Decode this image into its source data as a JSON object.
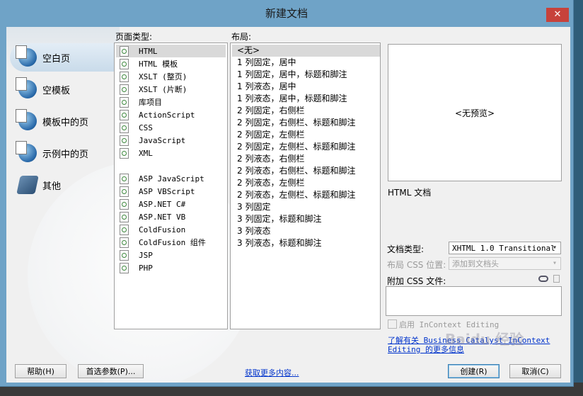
{
  "window": {
    "title": "新建文档",
    "close_label": "✕"
  },
  "categories": [
    {
      "label": "空白页",
      "icon": "blank-page-icon",
      "selected": true
    },
    {
      "label": "空模板",
      "icon": "blank-template-icon",
      "selected": false
    },
    {
      "label": "模板中的页",
      "icon": "template-page-icon",
      "selected": false
    },
    {
      "label": "示例中的页",
      "icon": "sample-page-icon",
      "selected": false
    },
    {
      "label": "其他",
      "icon": "other-icon",
      "selected": false
    }
  ],
  "page_type": {
    "label": "页面类型:",
    "items": [
      "HTML",
      "HTML 模板",
      "XSLT (整页)",
      "XSLT (片断)",
      "库项目",
      "ActionScript",
      "CSS",
      "JavaScript",
      "XML",
      "",
      "ASP JavaScript",
      "ASP VBScript",
      "ASP.NET C#",
      "ASP.NET VB",
      "ColdFusion",
      "ColdFusion 组件",
      "JSP",
      "PHP"
    ],
    "selected_index": 0
  },
  "layout": {
    "label": "布局:",
    "items": [
      "<无>",
      "1 列固定，居中",
      "1 列固定，居中，标题和脚注",
      "1 列液态，居中",
      "1 列液态，居中，标题和脚注",
      "2 列固定，右侧栏",
      "2 列固定，右侧栏、标题和脚注",
      "2 列固定，左侧栏",
      "2 列固定，左侧栏、标题和脚注",
      "2 列液态，右侧栏",
      "2 列液态，右侧栏、标题和脚注",
      "2 列液态，左侧栏",
      "2 列液态，左侧栏、标题和脚注",
      "3 列固定",
      "3 列固定，标题和脚注",
      "3 列液态",
      "3 列液态，标题和脚注"
    ],
    "selected_index": 0
  },
  "preview": {
    "text": "<无预览>",
    "description": "HTML 文档"
  },
  "doc_type": {
    "label": "文档类型:",
    "value": "XHTML 1.0 Transitional"
  },
  "layout_css": {
    "label": "布局 CSS 位置:",
    "value": "添加到文档头"
  },
  "attach_css": {
    "label": "附加 CSS 文件:"
  },
  "incontext": {
    "label": "启用 InContext Editing"
  },
  "learn_more": {
    "line1": "了解有关 Business Catalyst InContext",
    "line2": "Editing 的更多信息"
  },
  "buttons": {
    "help": "帮助(H)",
    "preferences": "首选参数(P)...",
    "get_more": "获取更多内容...",
    "create": "创建(R)",
    "cancel": "取消(C)"
  },
  "watermark": "Baidu 经验"
}
